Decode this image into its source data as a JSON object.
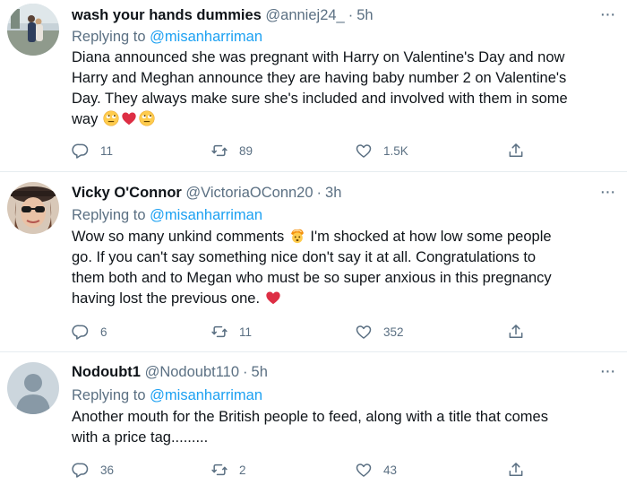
{
  "tweets": [
    {
      "name": "wash your hands dummies",
      "handle": "@anniej24_",
      "dot": "·",
      "time": "5h",
      "replying_prefix": "Replying to",
      "replying_to": "@misanharriman",
      "text_lines": [
        "Diana announced she was pregnant with Harry on Valentine's Day and now",
        "Harry and Meghan announce they are having baby number 2 on Valentine's",
        "Day. They always make sure she's included and involved with them in some",
        "way"
      ],
      "trailing_emojis": [
        "rolling-eyes-emoji",
        "red-heart-emoji",
        "rolling-eyes-emoji"
      ],
      "more_label": "···",
      "replies": "11",
      "retweets": "89",
      "likes": "1.5K"
    },
    {
      "name": "Vicky O'Connor",
      "handle": "@VictoriaOConn20",
      "dot": "·",
      "time": "3h",
      "replying_prefix": "Replying to",
      "replying_to": "@misanharriman",
      "text_line1_a": "Wow so many unkind comments",
      "text_line1_emoji": "exploding-head-emoji",
      "text_line1_b": "I'm shocked at how low some people",
      "text_lines": [
        "go. If you can't say something nice don't say it at all. Congratulations to",
        "them both and to Megan who must be so super anxious in this pregnancy"
      ],
      "text_last": "having lost the previous one.",
      "trailing_emojis": [
        "red-heart-emoji"
      ],
      "more_label": "···",
      "replies": "6",
      "retweets": "11",
      "likes": "352"
    },
    {
      "name": "Nodoubt1",
      "handle": "@Nodoubt110",
      "dot": "·",
      "time": "5h",
      "replying_prefix": "Replying to",
      "replying_to": "@misanharriman",
      "text_lines": [
        "Another mouth for the British people to feed, along with a title that comes",
        "with a price tag........."
      ],
      "more_label": "···",
      "replies": "36",
      "retweets": "2",
      "likes": "43"
    }
  ],
  "colors": {
    "name": "#0f1419",
    "secondary": "#5b7083",
    "mention": "#1da1f2",
    "divider": "#e6ecf0",
    "heart": "#e0245e"
  }
}
